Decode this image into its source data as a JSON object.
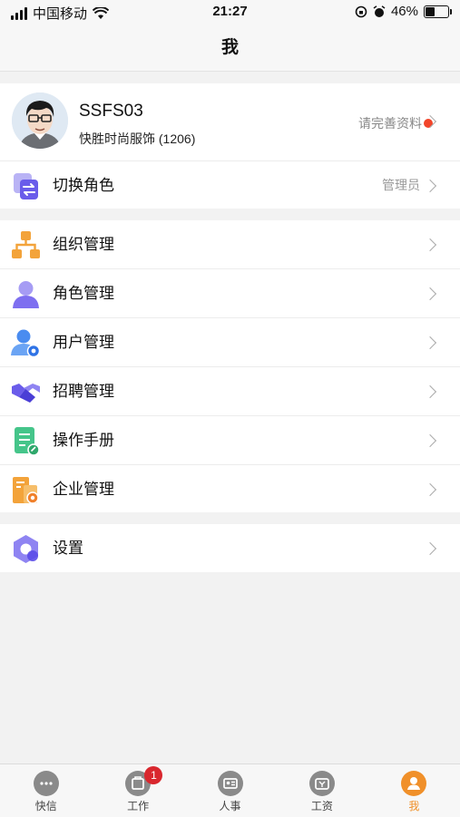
{
  "status_bar": {
    "carrier": "中国移动",
    "time": "21:27",
    "battery": "46%",
    "battery_level": 0.46
  },
  "header": {
    "title": "我"
  },
  "profile": {
    "name": "SSFS03",
    "company": "快胜时尚服饰 (1206)",
    "complete_hint": "请完善资料",
    "switch_role": {
      "label": "切换角色",
      "value": "管理员"
    }
  },
  "menu": [
    {
      "label": "组织管理",
      "icon": "org-chart-icon"
    },
    {
      "label": "角色管理",
      "icon": "person-icon"
    },
    {
      "label": "用户管理",
      "icon": "user-settings-icon"
    },
    {
      "label": "招聘管理",
      "icon": "handshake-icon"
    },
    {
      "label": "操作手册",
      "icon": "manual-icon"
    },
    {
      "label": "企业管理",
      "icon": "enterprise-icon"
    }
  ],
  "settings": {
    "label": "设置",
    "icon": "settings-icon"
  },
  "tabs": [
    {
      "label": "快信",
      "icon": "chat-icon"
    },
    {
      "label": "工作",
      "icon": "work-icon",
      "badge": "1"
    },
    {
      "label": "人事",
      "icon": "id-card-icon"
    },
    {
      "label": "工资",
      "icon": "wallet-icon"
    },
    {
      "label": "我",
      "icon": "me-icon",
      "active": true
    }
  ],
  "colors": {
    "accent": "#f0902a",
    "badge": "#d9272e",
    "dot": "#f2452a"
  }
}
